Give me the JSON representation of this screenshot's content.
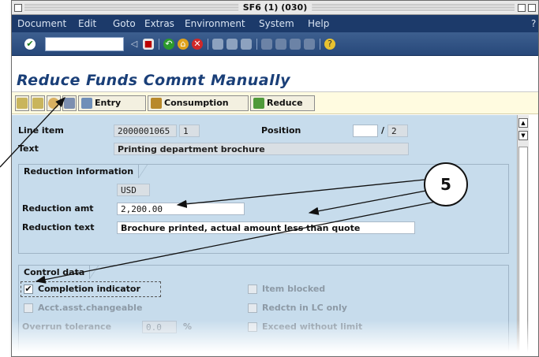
{
  "window": {
    "title": "SF6 (1) (030)"
  },
  "menu": [
    "Document",
    "Edit",
    "Goto",
    "Extras",
    "Environment",
    "System",
    "Help"
  ],
  "menu_help_mark": "?",
  "page_title": "Reduce Funds Commt Manually",
  "app_toolbar": {
    "entry": "Entry",
    "consumption": "Consumption",
    "reduce": "Reduce"
  },
  "header": {
    "line_item_label": "Line item",
    "line_item_value": "2000001065",
    "line_item_sub": "1",
    "position_label": "Position",
    "position_value": "",
    "position_sep": "/",
    "position_total": "2",
    "text_label": "Text",
    "text_value": "Printing department brochure"
  },
  "reduction": {
    "group_title": "Reduction information",
    "currency": "USD",
    "amt_label": "Reduction amt",
    "amt_value": "2,200.00",
    "text_label": "Reduction text",
    "text_value": "Brochure printed, actual amount less than quote"
  },
  "control": {
    "group_title": "Control data",
    "completion_label": "Completion indicator",
    "completion_checked": true,
    "acct_label": "Acct.asst.changeable",
    "overrun_label": "Overrun tolerance",
    "overrun_value": "0.0",
    "overrun_unit": "%",
    "item_blocked_label": "Item blocked",
    "redctn_label": "Redctn in LC only",
    "exceed_label": "Exceed without limit"
  },
  "callout": {
    "number": "5"
  },
  "colors": {
    "menubar": "#1c3a6a",
    "toolbar": "#27487a",
    "content": "#c7dcec",
    "appbar": "#fffbe0",
    "title": "#1a3f78"
  },
  "icons": [
    "save-icon",
    "back-icon",
    "exit-icon",
    "cancel-icon",
    "print-icon",
    "find-icon",
    "help-icon",
    "enter-icon",
    "entry-icon",
    "consumption-icon",
    "reduce-icon"
  ]
}
